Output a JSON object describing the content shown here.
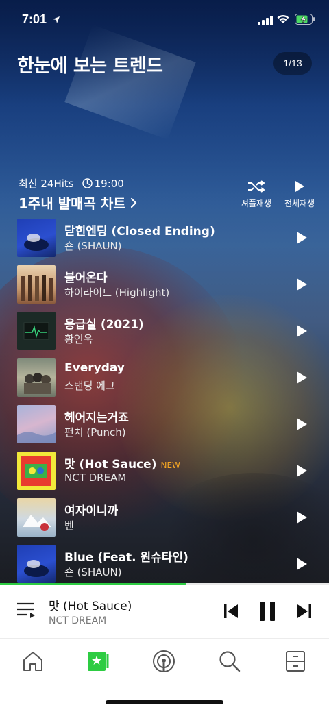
{
  "status_bar": {
    "time": "7:01"
  },
  "header": {
    "title": "한눈에 보는 트렌드",
    "page_indicator": "1/13"
  },
  "chart": {
    "subtitle": "최신 24Hits",
    "update_time": "19:00",
    "title": "1주내 발매곡 차트",
    "shuffle_label": "셔플재생",
    "play_all_label": "전체재생"
  },
  "songs": [
    {
      "title": "닫힌엔딩 (Closed Ending)",
      "artist": "숀 (SHAUN)",
      "badge": ""
    },
    {
      "title": "불어온다",
      "artist": "하이라이트 (Highlight)",
      "badge": ""
    },
    {
      "title": "응급실 (2021)",
      "artist": "황인욱",
      "badge": ""
    },
    {
      "title": "Everyday",
      "artist": "스탠딩 에그",
      "badge": ""
    },
    {
      "title": "헤어지는거죠",
      "artist": "펀치 (Punch)",
      "badge": ""
    },
    {
      "title": "맛 (Hot Sauce)",
      "artist": "NCT DREAM",
      "badge": "NEW"
    },
    {
      "title": "여자이니까",
      "artist": "벤",
      "badge": ""
    },
    {
      "title": "Blue (Feat. 원슈타인)",
      "artist": "숀 (SHAUN)",
      "badge": ""
    }
  ],
  "now_playing": {
    "title": "맛 (Hot Sauce)",
    "artist": "NCT DREAM",
    "progress": 0.565
  },
  "tabs": [
    {
      "name": "home",
      "icon": "home-icon"
    },
    {
      "name": "chart",
      "icon": "chart-icon",
      "active": true
    },
    {
      "name": "podcast",
      "icon": "podcast-icon"
    },
    {
      "name": "search",
      "icon": "search-icon"
    },
    {
      "name": "library",
      "icon": "library-icon"
    }
  ],
  "colors": {
    "accent": "#2dcc42",
    "new_badge": "#f5a623"
  }
}
